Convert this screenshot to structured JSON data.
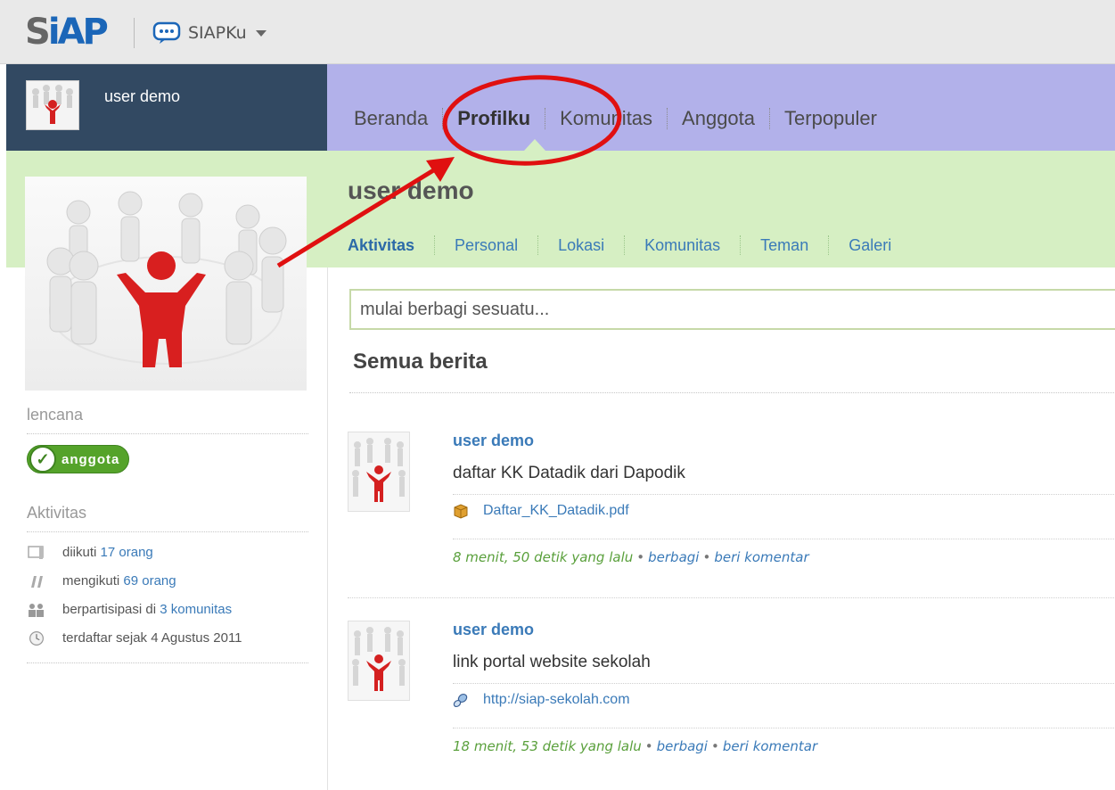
{
  "topbar": {
    "logo_text": "SiAP",
    "app_menu_label": "SIAPKu"
  },
  "user": {
    "name": "user demo"
  },
  "main_nav": [
    {
      "label": "Beranda"
    },
    {
      "label": "Profilku",
      "active": true
    },
    {
      "label": "Komunitas"
    },
    {
      "label": "Anggota"
    },
    {
      "label": "Terpopuler"
    }
  ],
  "profile": {
    "name": "user demo",
    "tabs": [
      {
        "label": "Aktivitas",
        "active": true
      },
      {
        "label": "Personal"
      },
      {
        "label": "Lokasi"
      },
      {
        "label": "Komunitas"
      },
      {
        "label": "Teman"
      },
      {
        "label": "Galeri"
      }
    ]
  },
  "sidebar": {
    "badges_title": "lencana",
    "badge_label": "anggota",
    "activity_title": "Aktivitas",
    "stats": [
      {
        "icon": "followers-icon",
        "text": "diikuti ",
        "link": "17 orang"
      },
      {
        "icon": "following-icon",
        "text": "mengikuti ",
        "link": "69 orang"
      },
      {
        "icon": "community-icon",
        "text": "berpartisipasi di ",
        "link": "3 komunitas"
      },
      {
        "icon": "clock-icon",
        "text": "terdaftar sejak 4 Agustus 2011",
        "link": ""
      }
    ]
  },
  "share": {
    "placeholder": "mulai berbagi sesuatu..."
  },
  "feed": {
    "title": "Semua berita",
    "posts": [
      {
        "user": "user demo",
        "text": "daftar KK Datadik dari Dapodik",
        "attachment": "Daftar_KK_Datadik.pdf",
        "attachment_icon": "package-icon",
        "time": "8 menit, 50 detik yang lalu",
        "share": "berbagi",
        "comment": "beri komentar"
      },
      {
        "user": "user demo",
        "text": "link portal website sekolah",
        "attachment": "http://siap-sekolah.com",
        "attachment_icon": "link-icon",
        "time": "18 menit, 53 detik yang lalu",
        "share": "berbagi",
        "comment": "beri komentar"
      }
    ]
  },
  "colors": {
    "nav_bg": "#b2b1ea",
    "user_bg": "#324962",
    "band_bg": "#d6efc3",
    "link": "#3a7ab8",
    "annotation": "#e01010"
  }
}
